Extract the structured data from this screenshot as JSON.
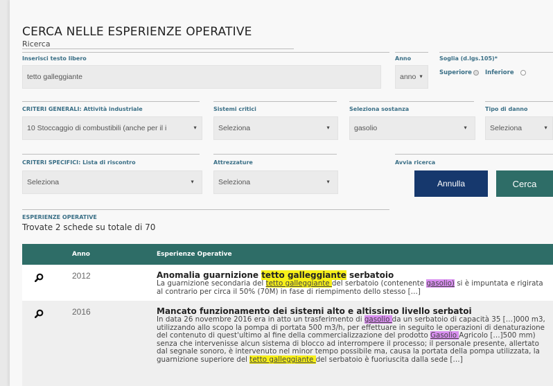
{
  "page": {
    "title": "CERCA NELLE ESPERIENZE OPERATIVE",
    "subtitle": "Ricerca"
  },
  "form": {
    "text_label": "Inserisci testo libero",
    "text_value": "tetto galleggiante",
    "anno_label": "Anno",
    "anno_value": "anno",
    "soglia_label": "Soglia (d.lgs.105)*",
    "soglia_superiore": "Superiore",
    "soglia_inferiore": "Inferiore",
    "criteri_generali_label": "CRITERI GENERALI: Attività industriale",
    "criteri_generali_value": "10 Stoccaggio di combustibili (anche per il i",
    "sistemi_critici_label": "Sistemi critici",
    "sistemi_critici_value": "Seleziona",
    "sostanza_label": "Seleziona sostanza",
    "sostanza_value": "gasolio",
    "tipo_danno_label": "Tipo di danno",
    "tipo_danno_value": "Seleziona",
    "criteri_specifici_label": "CRITERI SPECIFICI: Lista di riscontro",
    "criteri_specifici_value": "Seleziona",
    "attrezzature_label": "Attrezzature",
    "attrezzature_value": "Seleziona",
    "avvia_ricerca_label": "Avvia ricerca",
    "annulla_label": "Annulla",
    "cerca_label": "Cerca",
    "annulla_color": "#16386d",
    "cerca_color": "#2e6d67"
  },
  "results": {
    "section_label": "ESPERIENZE OPERATIVE",
    "count_text": "Trovate 2 schede su totale di 70",
    "col_anno": "Anno",
    "col_esperienze": "Esperienze Operative",
    "rows": [
      {
        "year": "2012",
        "title_pre": "Anomalia guarnizione ",
        "title_hl": "tetto galleggiante",
        "title_post": " serbatoio",
        "t1": "La guarnizione secondaria del ",
        "h1": "tetto galleggiante ",
        "t2": "del serbatoio (contenente ",
        "h2": "gasolio)",
        "t3": " si è impuntata e rigirata al contrario per circa il 50% (70M) in fase di riempimento dello stesso […]"
      },
      {
        "year": "2016",
        "title": "Mancato funzionamento dei sistemi alto e altissimo livello serbatoi",
        "t1": "In data 26 novembre 2016 era in atto un trasferimento di ",
        "h1": "gasolio ",
        "t2": "da un serbatoio di capacità 35 […]000 m3, utilizzando allo scopo la pompa di portata 500 m3/h, per effettuare in seguito le operazioni di denaturazione del contenuto di quest'ultimo al fine della commercializzazione del prodotto ",
        "h2": "Gasolio ",
        "t3": "Agricolo […]500 mm) senza che intervenisse alcun sistema di blocco ad interrompere il processo; il personale presente, allertato dal segnale sonoro, è intervenuto nel minor tempo possibile ma, causa la portata della pompa utilizzata, la guarnizione superiore del ",
        "h3": "tetto galleggiante ",
        "t4": "del serbatoio è fuoriuscita dalla sede […]"
      }
    ]
  }
}
